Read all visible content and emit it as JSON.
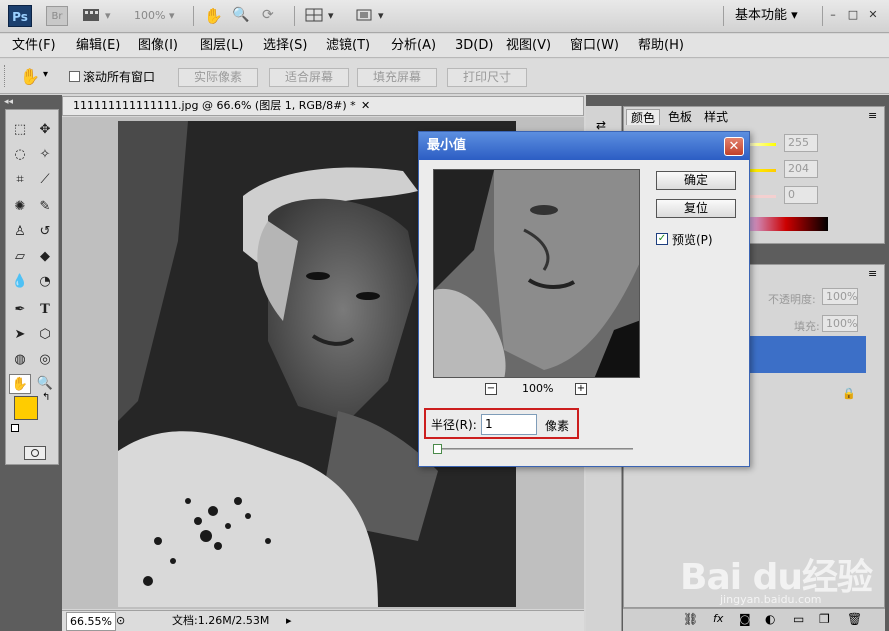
{
  "appbar": {
    "ps_logo": "Ps",
    "br_logo": "Br",
    "zoom_value": "100%",
    "workspace_label": "基本功能"
  },
  "menu": [
    "文件(F)",
    "编辑(E)",
    "图像(I)",
    "图层(L)",
    "选择(S)",
    "滤镜(T)",
    "分析(A)",
    "3D(D)",
    "视图(V)",
    "窗口(W)",
    "帮助(H)"
  ],
  "options": {
    "scroll_all_label": "滚动所有窗口",
    "buttons": [
      "实际像素",
      "适合屏幕",
      "填充屏幕",
      "打印尺寸"
    ]
  },
  "document": {
    "tab_title": "111111111111111.jpg @ 66.6% (图层 1, RGB/8#) *",
    "zoom_status": "66.55%",
    "doc_size": "文档:1.26M/2.53M"
  },
  "right_panel": {
    "tabs": [
      "颜色",
      "色板",
      "样式"
    ],
    "color_values": [
      "255",
      "204",
      "0"
    ],
    "opacity_label": "不透明度:",
    "opacity_value": "100%",
    "fill_label": "填充:",
    "fill_value": "100%"
  },
  "dialog": {
    "title": "最小值",
    "ok_label": "确定",
    "reset_label": "复位",
    "preview_label": "预览(P)",
    "preview_checked": true,
    "zoom_label": "100%",
    "radius_label": "半径(R):",
    "radius_value": "1",
    "unit_label": "像素"
  },
  "colors": {
    "foreground": "#ffcc00",
    "background": "#b0aabf",
    "selection": "#3c6fc7",
    "dialog_title": "#2c5dc4",
    "highlight_border": "#cc1e1e"
  },
  "watermark": {
    "brand": "Bai du经验",
    "url": "jingyan.baidu.com"
  }
}
